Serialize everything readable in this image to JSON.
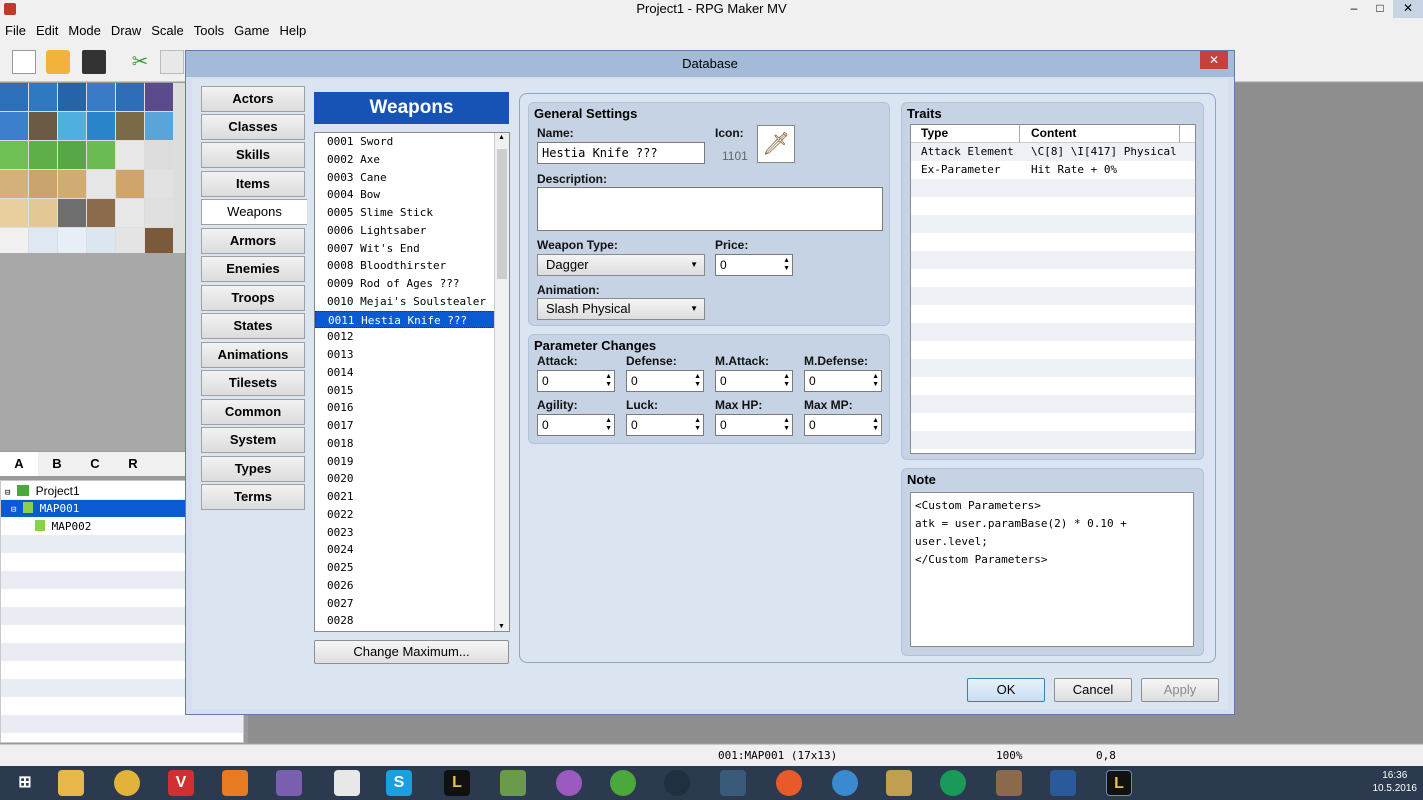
{
  "app": {
    "title": "Project1 - RPG Maker MV",
    "minimize": "–",
    "maximize": "□",
    "close": "✕"
  },
  "menu": [
    "File",
    "Edit",
    "Mode",
    "Draw",
    "Scale",
    "Tools",
    "Game",
    "Help"
  ],
  "layer_tabs": [
    "A",
    "B",
    "C",
    "R"
  ],
  "map_tree": {
    "project": "Project1",
    "maps": [
      "MAP001",
      "MAP002"
    ]
  },
  "status": {
    "map": "001:MAP001 (17x13)",
    "zoom": "100%",
    "coords": "0,8"
  },
  "dialog": {
    "title": "Database",
    "close": "✕",
    "categories": [
      "Actors",
      "Classes",
      "Skills",
      "Items",
      "Weapons",
      "Armors",
      "Enemies",
      "Troops",
      "States",
      "Animations",
      "Tilesets",
      "Common Events",
      "System",
      "Types",
      "Terms"
    ],
    "list_title": "Weapons",
    "weapons": [
      "0001 Sword",
      "0002 Axe",
      "0003 Cane",
      "0004 Bow",
      "0005 Slime Stick",
      "0006 Lightsaber",
      "0007 Wit's End",
      "0008 Bloodthirster",
      "0009 Rod of Ages ???",
      "0010 Mejai's Soulstealer ···",
      "0011 Hestia Knife ???",
      "0012",
      "0013",
      "0014",
      "0015",
      "0016",
      "0017",
      "0018",
      "0019",
      "0020",
      "0021",
      "0022",
      "0023",
      "0024",
      "0025",
      "0026",
      "0027",
      "0028"
    ],
    "change_max": "Change Maximum...",
    "general": {
      "title": "General Settings",
      "name_label": "Name:",
      "name_value": "Hestia Knife ???",
      "icon_label": "Icon:",
      "icon_index": "1101",
      "desc_label": "Description:",
      "desc_value": "",
      "wtype_label": "Weapon Type:",
      "wtype_value": "Dagger",
      "price_label": "Price:",
      "price_value": "0",
      "anim_label": "Animation:",
      "anim_value": "Slash Physical"
    },
    "params": {
      "title": "Parameter Changes",
      "labels": [
        "Attack:",
        "Defense:",
        "M.Attack:",
        "M.Defense:",
        "Agility:",
        "Luck:",
        "Max HP:",
        "Max MP:"
      ],
      "values": [
        "0",
        "0",
        "0",
        "0",
        "0",
        "0",
        "0",
        "0"
      ]
    },
    "traits": {
      "title": "Traits",
      "col_type": "Type",
      "col_content": "Content",
      "rows": [
        {
          "type": "Attack Element",
          "content": "\\C[8] \\I[417] Physical"
        },
        {
          "type": "Ex-Parameter",
          "content": "Hit Rate + 0%"
        }
      ]
    },
    "note": {
      "title": "Note",
      "lines": [
        "<Custom Parameters>",
        "atk = user.paramBase(2) * 0.10 + user.level;",
        "</Custom Parameters>"
      ]
    },
    "buttons": {
      "ok": "OK",
      "cancel": "Cancel",
      "apply": "Apply"
    }
  },
  "clock": {
    "time": "16:36",
    "date": "10.5.2016"
  }
}
